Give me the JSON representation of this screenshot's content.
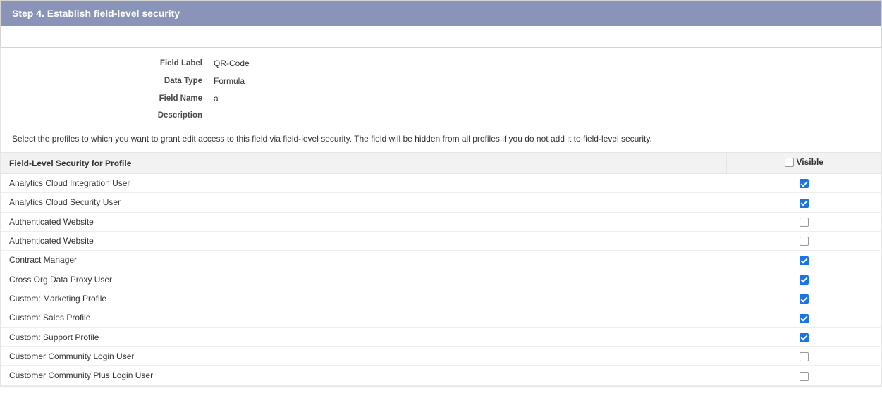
{
  "header": {
    "title": "Step 4. Establish field-level security"
  },
  "fieldDetails": {
    "labels": {
      "fieldLabel": "Field Label",
      "dataType": "Data Type",
      "fieldName": "Field Name",
      "description": "Description"
    },
    "values": {
      "fieldLabel": "QR-Code",
      "dataType": "Formula",
      "fieldName": "a",
      "description": ""
    }
  },
  "instructionText": "Select the profiles to which you want to grant edit access to this field via field-level security. The field will be hidden from all profiles if you do not add it to field-level security.",
  "table": {
    "headers": {
      "profile": "Field-Level Security for Profile",
      "visible": "Visible"
    },
    "headerVisibleChecked": false,
    "rows": [
      {
        "name": "Analytics Cloud Integration User",
        "visible": true
      },
      {
        "name": "Analytics Cloud Security User",
        "visible": true
      },
      {
        "name": "Authenticated Website",
        "visible": false
      },
      {
        "name": "Authenticated Website",
        "visible": false
      },
      {
        "name": "Contract Manager",
        "visible": true
      },
      {
        "name": "Cross Org Data Proxy User",
        "visible": true
      },
      {
        "name": "Custom: Marketing Profile",
        "visible": true
      },
      {
        "name": "Custom: Sales Profile",
        "visible": true
      },
      {
        "name": "Custom: Support Profile",
        "visible": true
      },
      {
        "name": "Customer Community Login User",
        "visible": false
      },
      {
        "name": "Customer Community Plus Login User",
        "visible": false
      }
    ]
  }
}
